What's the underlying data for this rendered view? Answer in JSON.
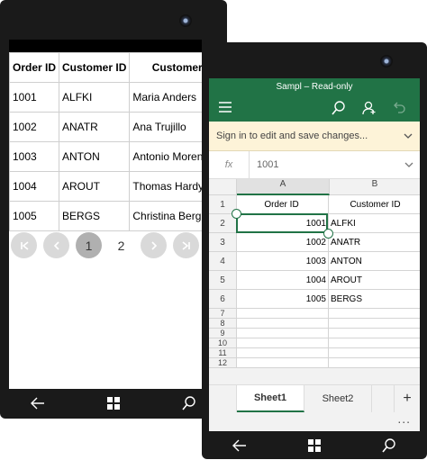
{
  "grid": {
    "columns": [
      "Order ID",
      "Customer ID",
      "Customer"
    ],
    "rows": [
      [
        "1001",
        "ALFKI",
        "Maria Anders"
      ],
      [
        "1002",
        "ANATR",
        "Ana Trujillo"
      ],
      [
        "1003",
        "ANTON",
        "Antonio Moreno"
      ],
      [
        "1004",
        "AROUT",
        "Thomas Hardy"
      ],
      [
        "1005",
        "BERGS",
        "Christina Berglund"
      ]
    ],
    "pager": {
      "page1": "1",
      "page2": "2"
    }
  },
  "excel": {
    "title": "Sampl – Read-only",
    "signin": "Sign in to edit and save changes...",
    "fx_label": "fx",
    "formula_value": "1001",
    "col_a": "A",
    "col_b": "B",
    "rows": [
      {
        "n": "1",
        "a": "Order ID",
        "b": "Customer ID"
      },
      {
        "n": "2",
        "a": "1001",
        "b": "ALFKI"
      },
      {
        "n": "3",
        "a": "1002",
        "b": "ANATR"
      },
      {
        "n": "4",
        "a": "1003",
        "b": "ANTON"
      },
      {
        "n": "5",
        "a": "1004",
        "b": "AROUT"
      },
      {
        "n": "6",
        "a": "1005",
        "b": "BERGS"
      }
    ],
    "empty_rows": [
      "7",
      "8",
      "9",
      "10",
      "11",
      "12"
    ],
    "tabs": [
      "Sheet1",
      "Sheet2"
    ],
    "add_tab": "+",
    "more": "..."
  },
  "colors": {
    "excel_green": "#217346",
    "signin_bg": "#fdf3d8"
  }
}
